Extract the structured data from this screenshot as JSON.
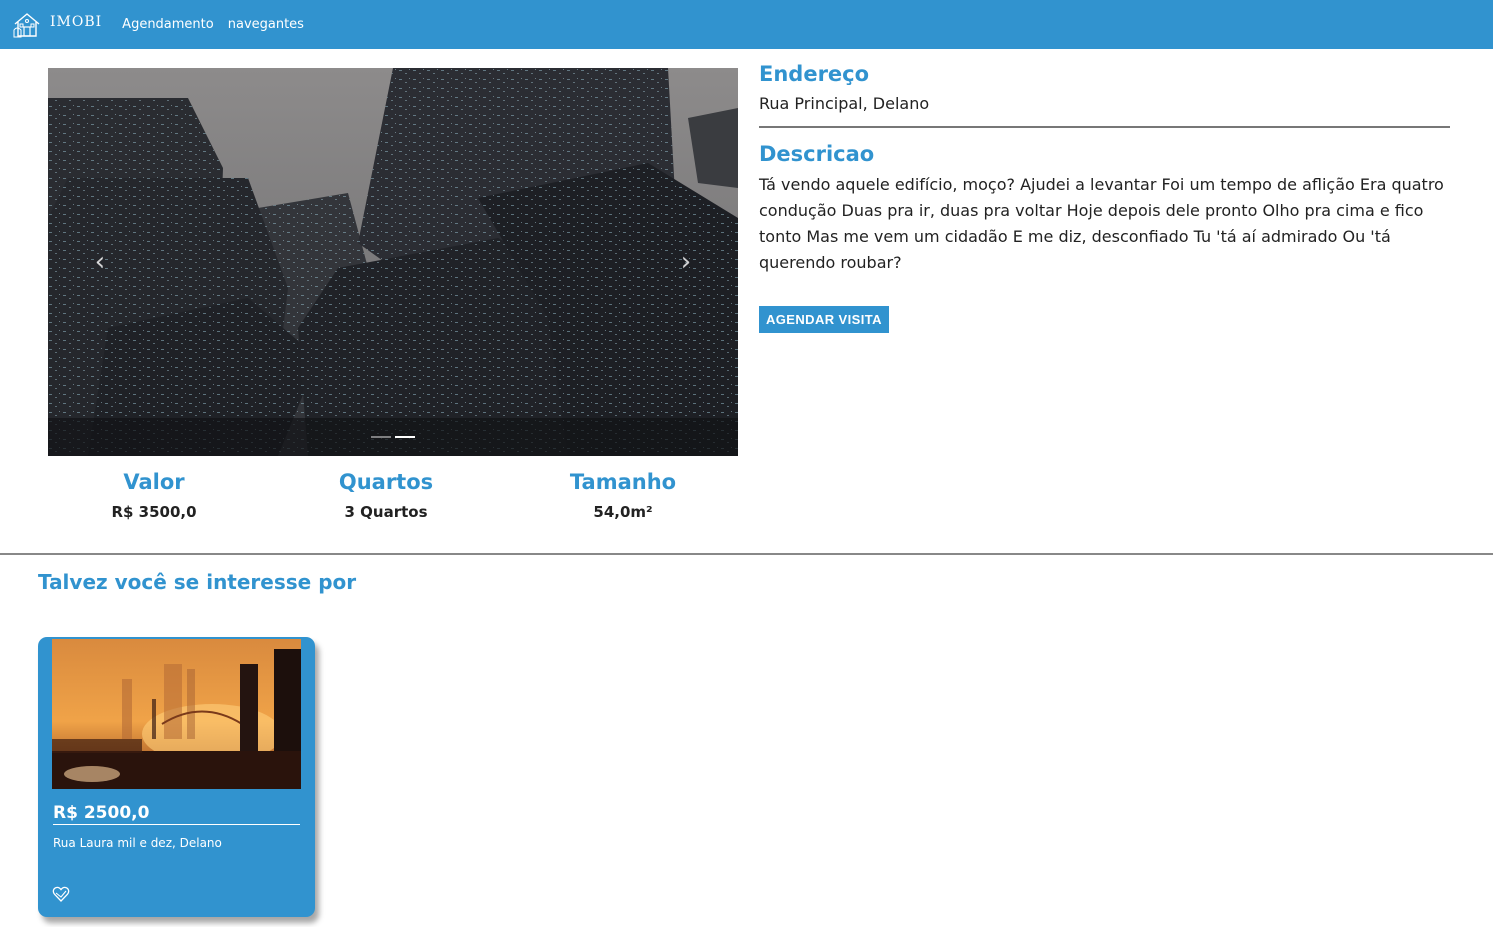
{
  "navbar": {
    "brand": "IMOBI",
    "links": [
      "Agendamento",
      "navegantes"
    ],
    "color": "#3193cf"
  },
  "carousel": {
    "prev_icon": "chevron-left-icon",
    "next_icon": "chevron-right-icon",
    "slide_count": 2,
    "active_slide": 2
  },
  "stats": [
    {
      "label": "Valor",
      "value": "R$ 3500,0"
    },
    {
      "label": "Quartos",
      "value": "3 Quartos"
    },
    {
      "label": "Tamanho",
      "value": "54,0m²"
    }
  ],
  "details": {
    "address_title": "Endereço",
    "address": "Rua Principal, Delano",
    "description_title": "Descricao",
    "description": "Tá vendo aquele edifício, moço? Ajudei a levantar Foi um tempo de aflição Era quatro condução Duas pra ir, duas pra voltar Hoje depois dele pronto Olho pra cima e fico tonto Mas me vem um cidadão E me diz, desconfiado Tu 'tá aí admirado Ou 'tá querendo roubar?",
    "visit_button": "AGENDAR VISITA"
  },
  "recommendations": {
    "title": "Talvez você se interesse por",
    "cards": [
      {
        "price": "R$ 2500,0",
        "address": "Rua Laura mil e dez, Delano",
        "fav_icon": "heart-outline-icon"
      }
    ]
  }
}
